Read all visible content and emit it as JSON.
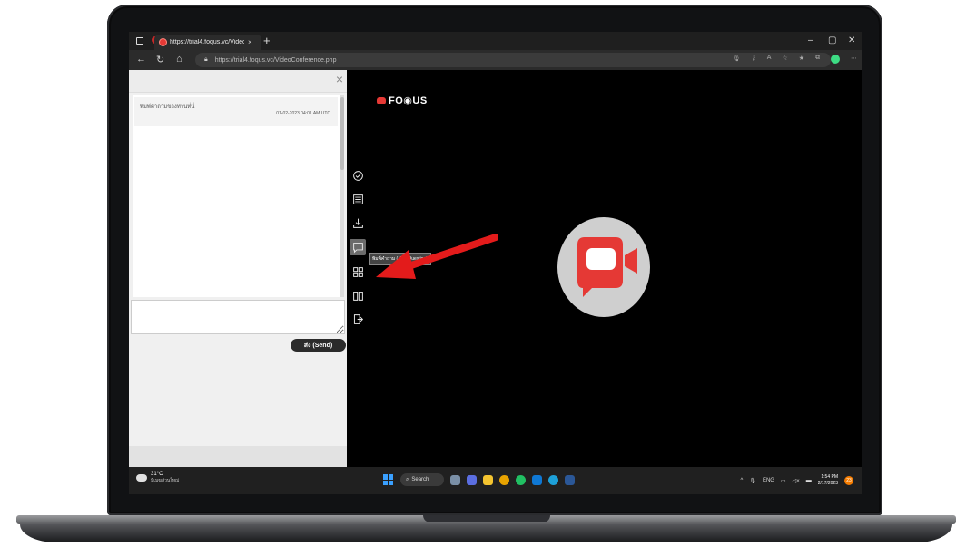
{
  "browser": {
    "tab_title": "https://trial4.foqus.vc/Video",
    "tab_close": "×",
    "new_tab": "+",
    "url_host": "https://trial4.foqus.vc",
    "url_path": "/VideoConference.php",
    "window_controls": [
      "–",
      "▢",
      "✕"
    ]
  },
  "app": {
    "logo_text": "FO◉US",
    "qa_panel": {
      "close": "×",
      "items": [
        {
          "question": "พิมพ์คำถามของท่านที่นี่",
          "timestamp": "01-02-2023 04:01 AM UTC"
        }
      ],
      "input_placeholder": "",
      "send_label": "ส่ง (Send)"
    },
    "toolbar": {
      "items": [
        "check-circle",
        "list",
        "download",
        "ask-question",
        "grid",
        "book",
        "exit"
      ],
      "active": "ask-question",
      "tooltip": "พิมพ์คำถาม ( Ask Question)"
    },
    "accent": "#e53935"
  },
  "taskbar": {
    "weather_temp": "31°C",
    "weather_desc": "มีเมฆส่วนใหญ่",
    "search_label": "Search",
    "lang": "ENG",
    "time": "1:54 PM",
    "date": "2/17/2023",
    "notif_count": "23"
  }
}
